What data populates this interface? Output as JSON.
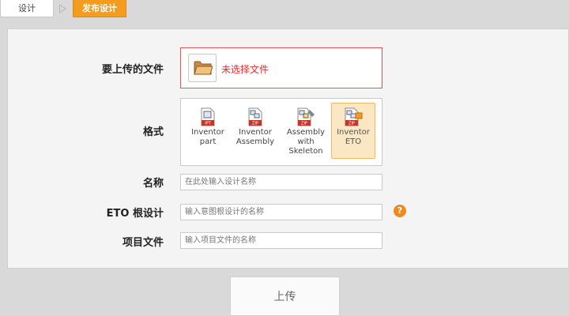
{
  "breadcrumb": {
    "design": "设计",
    "publish": "发布设计"
  },
  "form": {
    "file_label": "要上传的文件",
    "file_status": "未选择文件",
    "format_label": "格式",
    "formats": [
      {
        "badge": "IPT",
        "name": "Inventor part",
        "icon": "ipt-file-icon",
        "selected": false
      },
      {
        "badge": "ZIP",
        "name": "Inventor Assembly",
        "icon": "assembly-zip-icon",
        "selected": false
      },
      {
        "badge": "ZIP",
        "name": "Assembly with Skeleton",
        "icon": "skeleton-zip-icon",
        "selected": false
      },
      {
        "badge": "ZIP",
        "name": "Inventor ETO",
        "icon": "eto-zip-icon",
        "selected": true
      }
    ],
    "name_label": "名称",
    "name_placeholder": "在此处输入设计名称",
    "eto_label": "ETO 根设计",
    "eto_placeholder": "输入意图根设计的名称",
    "project_label": "项目文件",
    "project_placeholder": "输入项目文件的名称",
    "help_glyph": "?"
  },
  "actions": {
    "upload": "上传"
  },
  "colors": {
    "accent": "#f39c1f",
    "error": "#e03030",
    "selected_bg": "#fbe7c4"
  }
}
